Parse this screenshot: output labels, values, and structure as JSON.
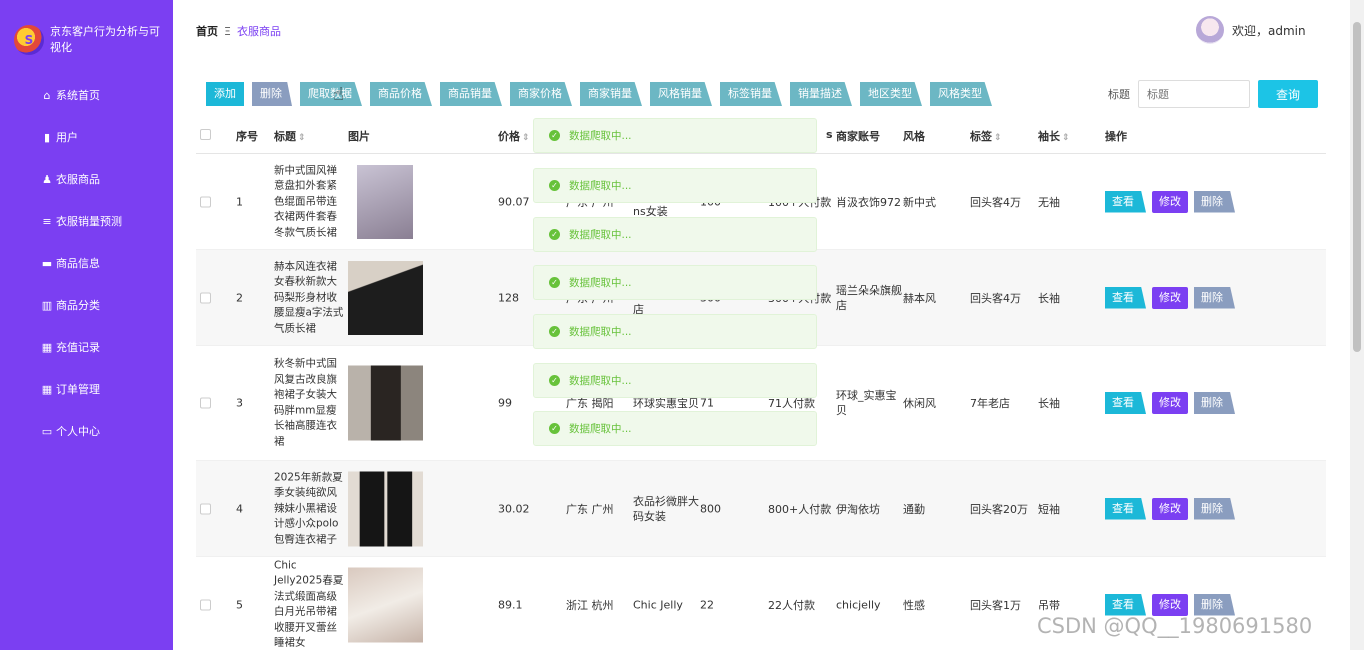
{
  "app": {
    "title": "京东客户行为分析与可视化",
    "logo_char": "S"
  },
  "sidebar": {
    "items": [
      {
        "icon": "home-icon",
        "glyph": "⌂",
        "label": "系统首页"
      },
      {
        "icon": "user-icon",
        "glyph": "▮",
        "label": "用户"
      },
      {
        "icon": "person-icon",
        "glyph": "♟",
        "label": "衣服商品"
      },
      {
        "icon": "list-icon",
        "glyph": "≡",
        "label": "衣服销量预测"
      },
      {
        "icon": "comment-icon",
        "glyph": "▬",
        "label": "商品信息"
      },
      {
        "icon": "bar-chart-icon",
        "glyph": "▥",
        "label": "商品分类"
      },
      {
        "icon": "grid-icon",
        "glyph": "▦",
        "label": "充值记录"
      },
      {
        "icon": "grid-icon",
        "glyph": "▦",
        "label": "订单管理"
      },
      {
        "icon": "card-icon",
        "glyph": "▭",
        "label": "个人中心"
      }
    ]
  },
  "breadcrumb": {
    "home": "首页",
    "sep": "Ξ",
    "current": "衣服商品"
  },
  "user": {
    "greeting": "欢迎，admin"
  },
  "toolbar": {
    "buttons": [
      "添加",
      "删除",
      "爬取数据",
      "商品价格",
      "商品销量",
      "商家价格",
      "商家销量",
      "风格销量",
      "标签销量",
      "销量描述",
      "地区类型",
      "风格类型"
    ]
  },
  "search": {
    "label": "标题",
    "placeholder": "标题",
    "button": "查询"
  },
  "table": {
    "headers": [
      "序号",
      "标题",
      "图片",
      "价格",
      "商家账号",
      "风格",
      "标签",
      "袖长",
      "操作"
    ],
    "partial_header": "s",
    "rows": [
      {
        "idx": "1",
        "title": "新中式国风禅意盘扣外套紧色绲面吊带连衣裙两件套春冬款气质长裙",
        "price": "90.07",
        "location": "广东 广州",
        "shop": "ns女装",
        "sales": "100",
        "paid": "100+人付款",
        "account": "肖汲衣饰972",
        "style": "新中式",
        "tag": "回头客4万",
        "sleeve": "无袖",
        "img": [
          "#c9c3d4",
          "#8a7f93"
        ]
      },
      {
        "idx": "2",
        "title": "赫本风连衣裙女春秋新款大码梨形身材收腰显瘦a字法式气质长裙",
        "price": "128",
        "location": "广东 广州",
        "shop": "店",
        "sales": "300",
        "paid": "300+人付款",
        "account": "瑶兰朵朵旗舰店",
        "style": "赫本风",
        "tag": "回头客4万",
        "sleeve": "长袖",
        "img": [
          "#d8d0c6",
          "#1d1d1d"
        ]
      },
      {
        "idx": "3",
        "title": "秋冬新中式国风复古改良旗袍裙子女装大码胖mm显瘦长袖高腰连衣裙",
        "price": "99",
        "location": "广东 揭阳",
        "shop": "环球实惠宝贝",
        "sales": "71",
        "paid": "71人付款",
        "account": "环球_实惠宝贝",
        "style": "休闲风",
        "tag": "7年老店",
        "sleeve": "长袖",
        "img": [
          "#b9b2aa",
          "#2a2522"
        ]
      },
      {
        "idx": "4",
        "title": "2025年新款夏季女装纯欲风辣妹小黑裙设计感小众polo包臀连衣裙子",
        "price": "30.02",
        "location": "广东 广州",
        "shop": "衣品衫微胖大码女装",
        "sales": "800",
        "paid": "800+人付款",
        "account": "伊淘依坊",
        "style": "通勤",
        "tag": "回头客20万",
        "sleeve": "短袖",
        "img": [
          "#e2dbd3",
          "#151515"
        ]
      },
      {
        "idx": "5",
        "title": "Chic Jelly2025春夏法式缎面高级白月光吊带裙收腰开叉蕾丝睡裙女",
        "price": "89.1",
        "location": "浙江 杭州",
        "shop": "Chic Jelly",
        "sales": "22",
        "paid": "22人付款",
        "account": "chicjelly",
        "style": "性感",
        "tag": "回头客1万",
        "sleeve": "吊带",
        "img": [
          "#d9c9bf",
          "#f1ece6"
        ]
      }
    ],
    "actions": {
      "view": "查看",
      "edit": "修改",
      "delete": "删除"
    }
  },
  "toasts": [
    "数据爬取中...",
    "数据爬取中...",
    "数据爬取中...",
    "数据爬取中...",
    "数据爬取中...",
    "数据爬取中...",
    "数据爬取中..."
  ],
  "watermark": "CSDN @QQ__1980691580",
  "colors": {
    "sidebar": "#7b3ff2",
    "accent": "#1cb8d8",
    "success": "#67c23a"
  }
}
